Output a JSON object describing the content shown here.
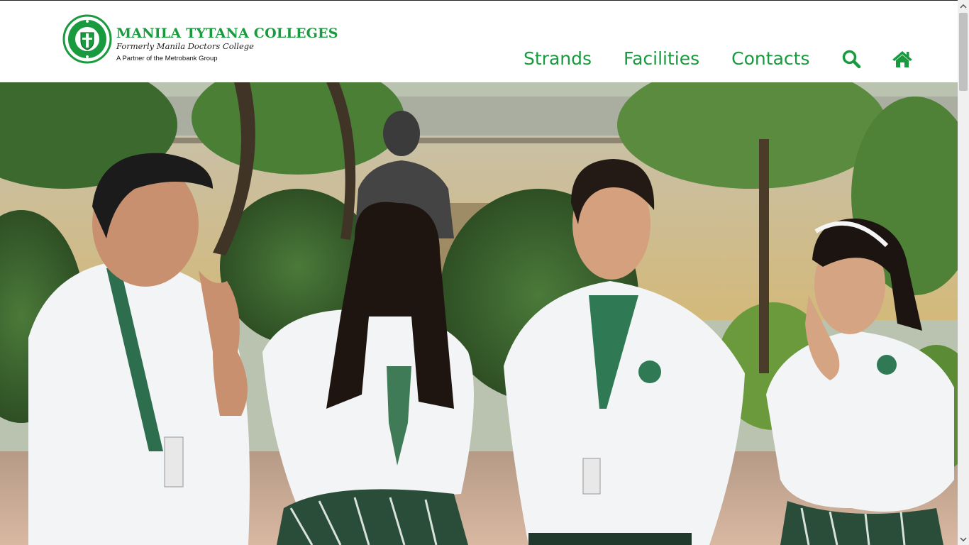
{
  "header": {
    "brand_name": "MANILA TYTANA COLLEGES",
    "brand_subtitle": "Formerly Manila Doctors College",
    "brand_partner": "A Partner of the Metrobank Group",
    "seal_text_top": "MANILA TYTANA",
    "seal_text_bottom": "COLLEGES"
  },
  "nav": {
    "items": [
      {
        "label": "Strands"
      },
      {
        "label": "Facilities"
      },
      {
        "label": "Contacts"
      }
    ],
    "search_icon": "search-icon",
    "home_icon": "home-icon"
  },
  "hero": {
    "image_alt": "students-in-uniform-photo"
  },
  "colors": {
    "brand_green": "#1a9a3e",
    "header_bg": "#ffffff"
  }
}
